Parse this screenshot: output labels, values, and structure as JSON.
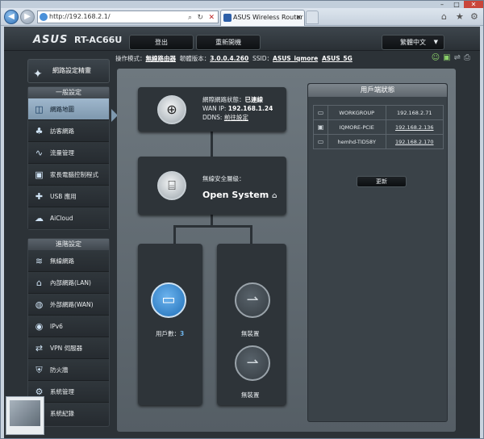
{
  "browser": {
    "address": "http://192.168.2.1/",
    "tab_title": "ASUS Wireless Router RT-...",
    "tab_close": "×",
    "window_controls": {
      "minimize": "–",
      "maximize": "□",
      "close": "✕"
    },
    "icons": {
      "back": "back-arrow-icon",
      "forward": "forward-arrow-icon",
      "search": "search-icon",
      "refresh": "refresh-icon",
      "stop": "stop-icon",
      "home": "home-icon",
      "favorites": "star-icon",
      "tools": "gear-icon"
    }
  },
  "header": {
    "brand": "ASUS",
    "model": "RT-AC66U",
    "logout_label": "登出",
    "reboot_label": "重新開機",
    "language": "繁體中文"
  },
  "status": {
    "mode_label": "操作模式：",
    "mode_value": "無線路由器",
    "firmware_label": "韌體版本：",
    "firmware_value": "3.0.0.4.260",
    "ssid_label": "SSID：",
    "ssid_1": "ASUS_iqmore",
    "ssid_2": "ASUS_5G"
  },
  "sidebar": {
    "quick_setup": "網路設定精靈",
    "general_title": "一般設定",
    "general_items": [
      {
        "label": "網路地圖",
        "icon": "network-map-icon"
      },
      {
        "label": "訪客網路",
        "icon": "guest-network-icon"
      },
      {
        "label": "流量管理",
        "icon": "traffic-manager-icon"
      },
      {
        "label": "家長電腦控制程式",
        "icon": "parental-control-icon"
      },
      {
        "label": "USB 應用",
        "icon": "usb-application-icon"
      },
      {
        "label": "AiCloud",
        "icon": "aicloud-icon"
      }
    ],
    "advanced_title": "進階設定",
    "advanced_items": [
      {
        "label": "無線網路",
        "icon": "wireless-icon"
      },
      {
        "label": "內部網路(LAN)",
        "icon": "lan-icon"
      },
      {
        "label": "外部網路(WAN)",
        "icon": "wan-icon"
      },
      {
        "label": "IPv6",
        "icon": "ipv6-icon"
      },
      {
        "label": "VPN 伺服器",
        "icon": "vpn-icon"
      },
      {
        "label": "防火牆",
        "icon": "firewall-icon"
      },
      {
        "label": "系統管理",
        "icon": "administration-icon"
      },
      {
        "label": "系統紀錄",
        "icon": "system-log-icon"
      }
    ]
  },
  "map": {
    "internet": {
      "status_label": "網際網路狀態：",
      "status_value": "已連線",
      "wan_label": "WAN IP:",
      "wan_ip": "192.168.1.24",
      "ddns_label": "DDNS:",
      "ddns_value": "前往設定"
    },
    "wireless": {
      "security_label": "無線安全層級：",
      "security_value": "Open System"
    },
    "clients": {
      "label": "用戶數：",
      "count": "3"
    },
    "usb1": {
      "label": "無裝置"
    },
    "usb2": {
      "label": "無裝置"
    }
  },
  "client_status": {
    "title": "用戶端狀態",
    "rows": [
      {
        "name": "WORKGROUP",
        "ip": "192.168.2.71",
        "link": false,
        "icon": "computer-icon"
      },
      {
        "name": "IQMORE-PCIE",
        "ip": "192.168.2.136",
        "link": true,
        "icon": "computer-icon"
      },
      {
        "name": "hemhd-TID58Y",
        "ip": "192.168.2.170",
        "link": true,
        "icon": "computer-icon"
      }
    ],
    "refresh_label": "更新"
  }
}
